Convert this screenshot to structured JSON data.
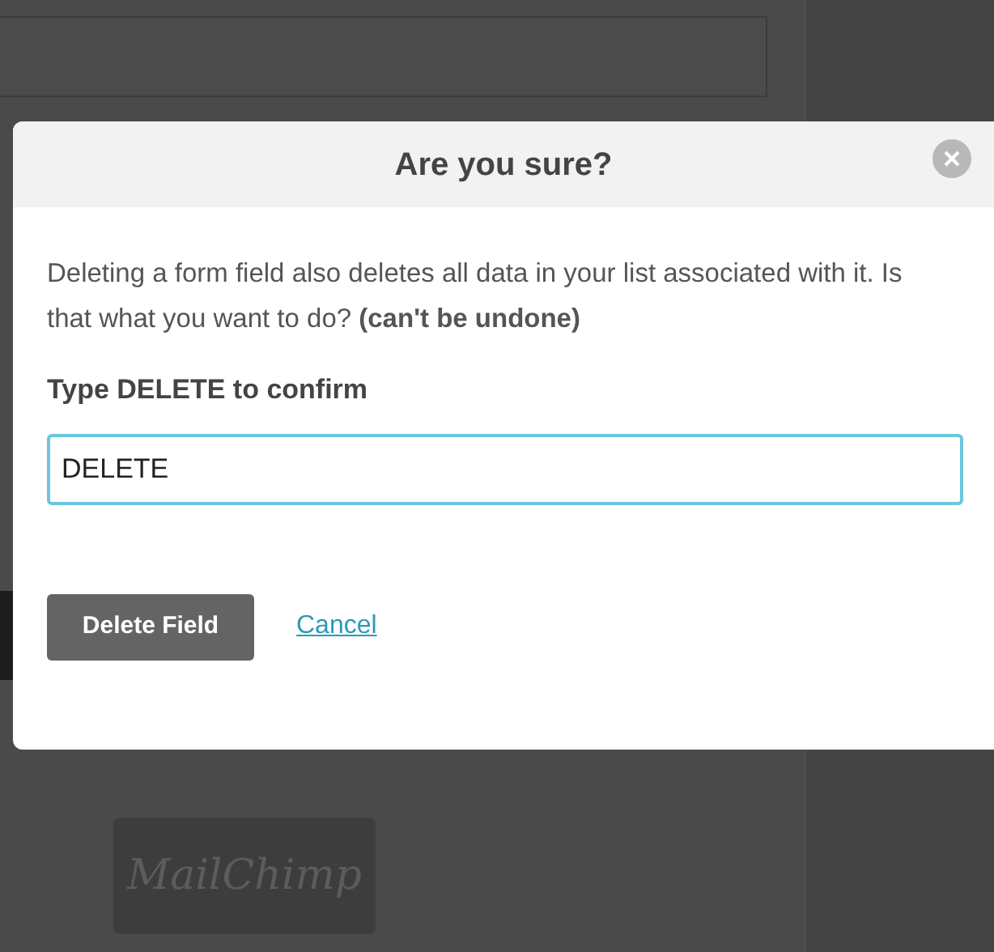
{
  "dialog": {
    "title": "Are you sure?",
    "message": "Deleting a form field also deletes all data in your list associated with it. Is that what you want to do? **(can't be undone)**",
    "confirm_label": "Type DELETE to confirm",
    "confirm_input": {
      "value": "DELETE"
    },
    "primary_button": "Delete Field",
    "cancel_link": "Cancel"
  },
  "footer": {
    "logo": "MailChimp"
  }
}
